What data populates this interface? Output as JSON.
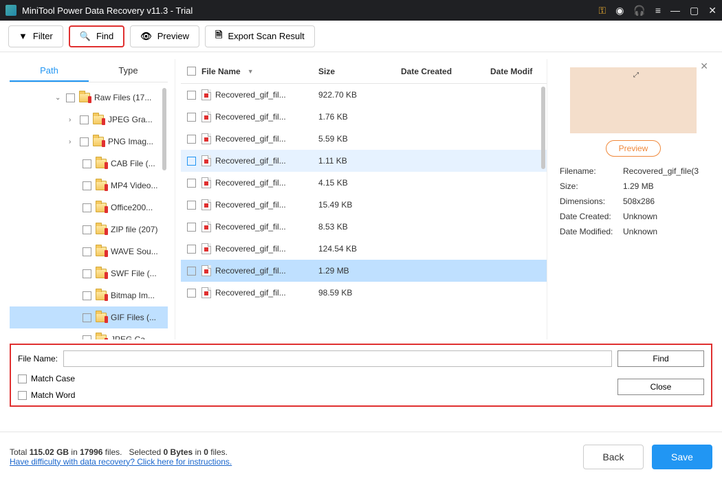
{
  "titlebar": {
    "title": "MiniTool Power Data Recovery v11.3 - Trial"
  },
  "toolbar": {
    "filter": "Filter",
    "find": "Find",
    "preview": "Preview",
    "export": "Export Scan Result"
  },
  "tabs": {
    "path": "Path",
    "type": "Type"
  },
  "tree": [
    {
      "label": "Raw Files (17...",
      "depth": 0,
      "expand": "v",
      "sel": false
    },
    {
      "label": "JPEG Gra...",
      "depth": 1,
      "expand": ">",
      "sel": false
    },
    {
      "label": "PNG Imag...",
      "depth": 1,
      "expand": ">",
      "sel": false
    },
    {
      "label": "CAB File (...",
      "depth": 2,
      "expand": "",
      "sel": false
    },
    {
      "label": "MP4 Video...",
      "depth": 2,
      "expand": "",
      "sel": false
    },
    {
      "label": "Office200...",
      "depth": 2,
      "expand": "",
      "sel": false
    },
    {
      "label": "ZIP file (207)",
      "depth": 2,
      "expand": "",
      "sel": false
    },
    {
      "label": "WAVE Sou...",
      "depth": 2,
      "expand": "",
      "sel": false
    },
    {
      "label": "SWF File (...",
      "depth": 2,
      "expand": "",
      "sel": false
    },
    {
      "label": "Bitmap Im...",
      "depth": 2,
      "expand": "",
      "sel": false
    },
    {
      "label": "GIF Files (...",
      "depth": 2,
      "expand": "",
      "sel": true
    },
    {
      "label": "JPEG Ca...",
      "depth": 2,
      "expand": "",
      "sel": false
    }
  ],
  "filelist": {
    "headers": {
      "name": "File Name",
      "size": "Size",
      "created": "Date Created",
      "modified": "Date Modif"
    },
    "rows": [
      {
        "name": "Recovered_gif_fil...",
        "size": "922.70 KB",
        "sel": ""
      },
      {
        "name": "Recovered_gif_fil...",
        "size": "1.76 KB",
        "sel": ""
      },
      {
        "name": "Recovered_gif_fil...",
        "size": "5.59 KB",
        "sel": ""
      },
      {
        "name": "Recovered_gif_fil...",
        "size": "1.11 KB",
        "sel": "sel2"
      },
      {
        "name": "Recovered_gif_fil...",
        "size": "4.15 KB",
        "sel": ""
      },
      {
        "name": "Recovered_gif_fil...",
        "size": "15.49 KB",
        "sel": ""
      },
      {
        "name": "Recovered_gif_fil...",
        "size": "8.53 KB",
        "sel": ""
      },
      {
        "name": "Recovered_gif_fil...",
        "size": "124.54 KB",
        "sel": ""
      },
      {
        "name": "Recovered_gif_fil...",
        "size": "1.29 MB",
        "sel": "sel"
      },
      {
        "name": "Recovered_gif_fil...",
        "size": "98.59 KB",
        "sel": ""
      }
    ]
  },
  "preview": {
    "button": "Preview",
    "meta": {
      "filename_k": "Filename:",
      "filename_v": "Recovered_gif_file(3",
      "size_k": "Size:",
      "size_v": "1.29 MB",
      "dim_k": "Dimensions:",
      "dim_v": "508x286",
      "created_k": "Date Created:",
      "created_v": "Unknown",
      "modified_k": "Date Modified:",
      "modified_v": "Unknown"
    }
  },
  "find": {
    "label": "File Name:",
    "match_case": "Match Case",
    "match_word": "Match Word",
    "find_btn": "Find",
    "close_btn": "Close"
  },
  "footer": {
    "total_prefix": "Total ",
    "total_gb": "115.02 GB",
    "in": " in ",
    "total_files": "17996",
    "files_suffix": " files.",
    "selected_prefix": "Selected ",
    "selected_bytes": "0 Bytes",
    "selected_files": "0",
    "help": "Have difficulty with data recovery? Click here for instructions.",
    "back": "Back",
    "save": "Save"
  }
}
